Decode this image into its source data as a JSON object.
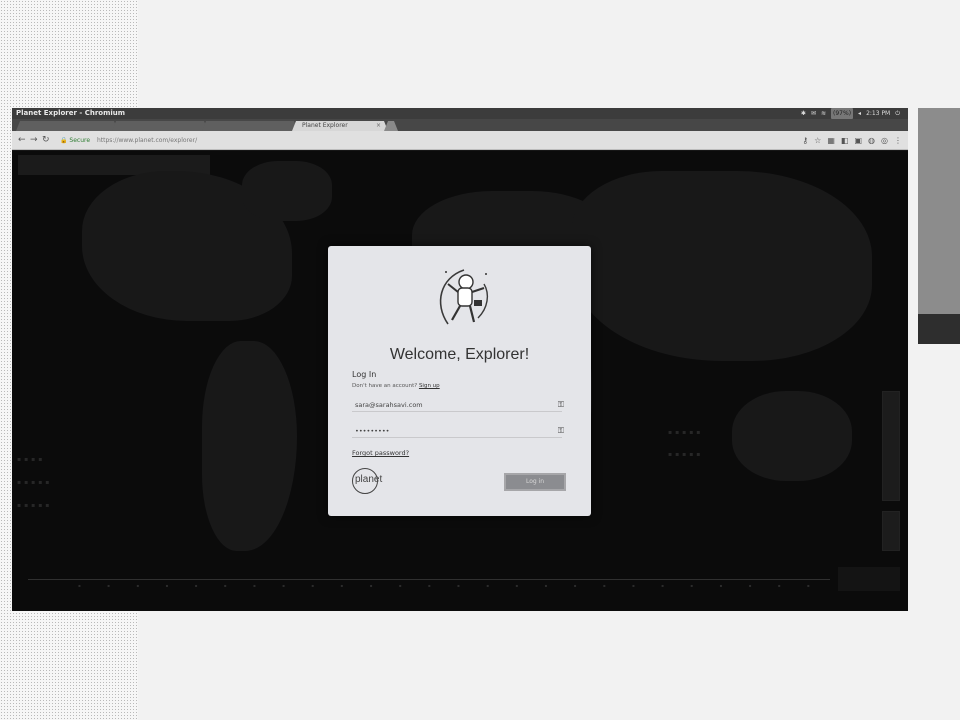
{
  "window": {
    "title": "Planet Explorer - Chromium",
    "tray": {
      "battery": "(97%)",
      "time": "2:13 PM"
    }
  },
  "tabs": [
    {
      "label": ""
    },
    {
      "label": ""
    },
    {
      "label": "Planet Explorer"
    }
  ],
  "toolbar": {
    "url_security": "Secure",
    "url": "https://www.planet.com/explorer/"
  },
  "modal": {
    "title": "Welcome, Explorer!",
    "section": "Log In",
    "signup_prompt": "Don't have an account?",
    "signup_link": "Sign up",
    "email": "sara@sarahsavi.com",
    "password": "•••••••••",
    "forgot_password": "Forgot password?",
    "logo_text": "planet",
    "login_button": "Log in"
  },
  "colors": {
    "modal_bg": "#e4e5e9",
    "map_bg": "#111112",
    "land": "#252526",
    "button": "#8b8c90"
  },
  "icons": [
    "back-icon",
    "forward-icon",
    "reload-icon",
    "lock-icon",
    "key-icon"
  ]
}
